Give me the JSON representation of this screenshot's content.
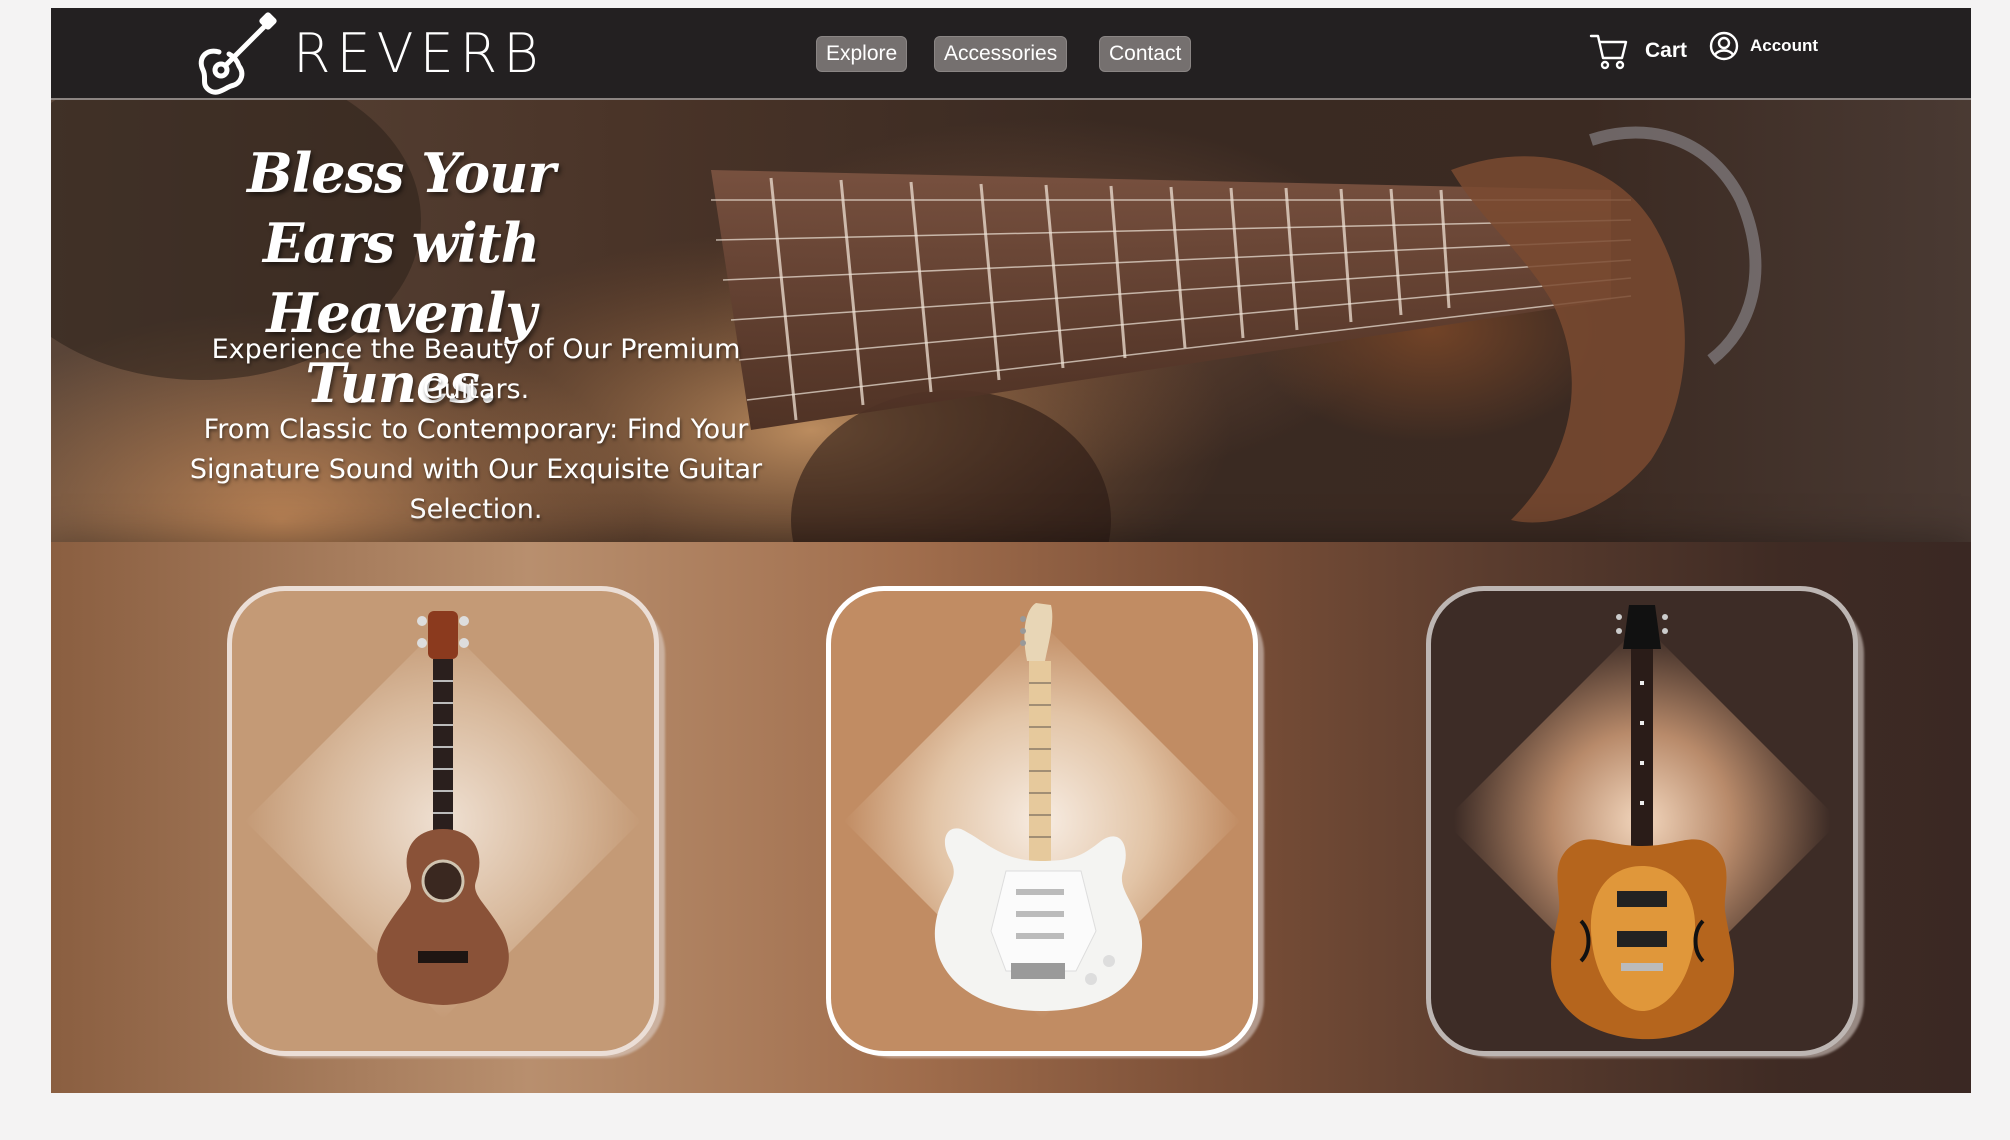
{
  "brand": {
    "name": "REVERB",
    "logo_icon": "guitar-icon"
  },
  "nav": {
    "links": [
      {
        "label": "Explore"
      },
      {
        "label": "Accessories"
      },
      {
        "label": "Contact"
      }
    ],
    "cart_label": "Cart",
    "cart_icon": "shopping-cart-icon",
    "account_label": "Account",
    "account_icon": "user-circle-icon"
  },
  "hero": {
    "title_line1": "Bless Your Ears with",
    "title_line2": "Heavenly Tunes.",
    "subtitle_line1": "Experience the Beauty of Our Premium",
    "subtitle_line2": "Guitars.",
    "subtitle_line3": "From Classic to Contemporary: Find Your",
    "subtitle_line4": "Signature Sound with Our Exquisite Guitar",
    "subtitle_line5": "Selection."
  },
  "products": [
    {
      "name": "ukulele",
      "icon": "ukulele-icon",
      "card_bg": "#c49a76"
    },
    {
      "name": "electric-guitar",
      "icon": "electric-guitar-icon",
      "card_bg": "#c18c63"
    },
    {
      "name": "hollow-body-guitar",
      "icon": "hollow-body-guitar-icon",
      "card_bg": "#3d2c26"
    }
  ],
  "colors": {
    "nav_bg": "#232021",
    "nav_button_bg": "#75706f",
    "accent_wood": "#c18c63"
  }
}
